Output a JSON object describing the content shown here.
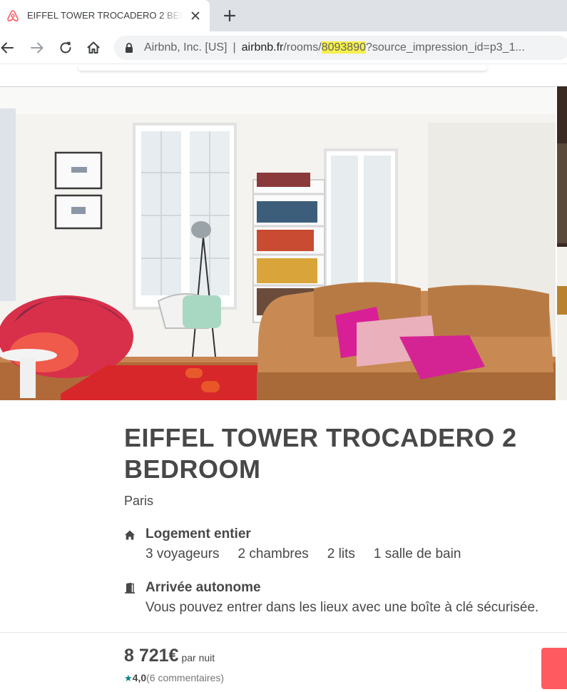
{
  "browser": {
    "tab_title": "EIFFEL TOWER TROCADERO 2 BEDROOM",
    "new_tab_symbol": "+",
    "omnibox": {
      "site_identity": "Airbnb, Inc. [US]",
      "separator": "|",
      "domain": "airbnb.fr",
      "path_prefix": "/rooms/",
      "room_id": "8093890",
      "query": "?source_impression_id=p3_1..."
    },
    "icons": [
      "airbnb-favicon",
      "close-icon",
      "plus-icon",
      "back-arrow-icon",
      "forward-arrow-icon",
      "reload-icon",
      "home-icon",
      "lock-icon"
    ]
  },
  "listing": {
    "photo_description": "Living room with leather sofa, pink cushions, red armchair and bookshelf",
    "title": "EIFFEL TOWER TROCADERO 2 BEDROOM",
    "city": "Paris",
    "features": [
      {
        "icon": "home-icon",
        "title": "Logement entier",
        "details": [
          "3 voyageurs",
          "2 chambres",
          "2 lits",
          "1 salle de bain"
        ]
      },
      {
        "icon": "door-icon",
        "title": "Arrivée autonome",
        "description": "Vous pouvez entrer dans les lieux avec une boîte à clé sécurisée."
      }
    ],
    "price": {
      "amount": "8 721€",
      "unit": "par nuit"
    },
    "rating": {
      "star": "★",
      "score": "4,0",
      "reviews": "(6 commentaires)"
    }
  },
  "colors": {
    "brand": "#ff5a5f",
    "teal": "#008489",
    "text": "#484848",
    "highlight": "#f7f04a"
  }
}
